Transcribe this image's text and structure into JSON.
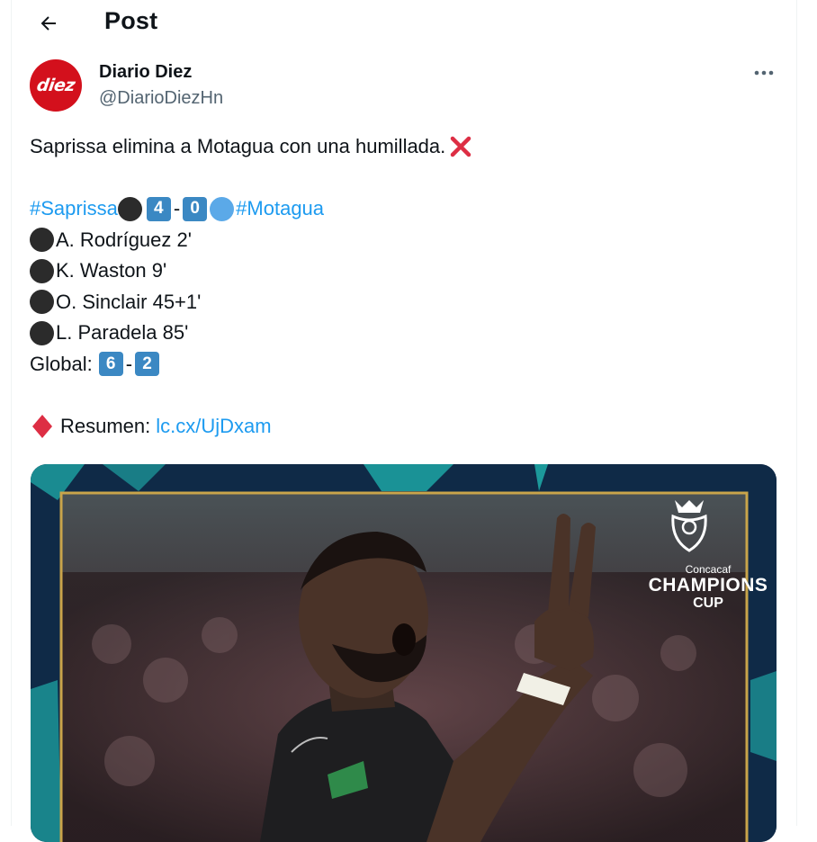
{
  "header": {
    "title": "Post",
    "back_icon": "arrow-left-icon"
  },
  "author": {
    "name": "Diario Diez",
    "handle": "@DiarioDiezHn",
    "avatar_text": "diez",
    "avatar_color": "#d3101c"
  },
  "tweet": {
    "line1": "Saprissa elimina a Motagua con una humillada.",
    "score": {
      "home_tag": "#Saprissa",
      "home_score": "4",
      "separator": "-",
      "away_score": "0",
      "away_tag": "#Motagua"
    },
    "goals": [
      "A. Rodríguez 2'",
      "K. Waston 9'",
      "O. Sinclair 45+1'",
      "L. Paradela 85'"
    ],
    "global": {
      "label": "Global:",
      "home": "6",
      "separator": "-",
      "away": "2"
    },
    "summary": {
      "label": "Resumen:",
      "link": "lc.cx/UjDxam"
    }
  },
  "media": {
    "badge_line1": "Concacaf",
    "badge_line2": "CHAMPIONS",
    "badge_line3": "CUP"
  },
  "colors": {
    "link": "#1d9bf0",
    "handle": "#536471",
    "keycap": "#3b88c3"
  }
}
